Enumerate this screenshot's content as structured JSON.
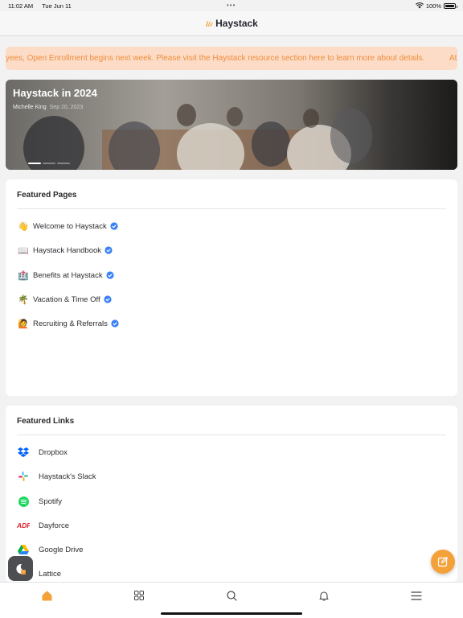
{
  "status_bar": {
    "time": "11:02 AM",
    "date": "Tue Jun 11",
    "battery": "100%",
    "dots": "•••"
  },
  "header": {
    "brand": "Haystack"
  },
  "announcement": {
    "text": "yees, Open Enrollment begins next week. Please visit the Haystack resource section here to learn more about details.",
    "text_continued": "At"
  },
  "hero": {
    "title": "Haystack in 2024",
    "author": "Michelle King",
    "date": "Sep 20, 2023"
  },
  "featured_pages": {
    "title": "Featured Pages",
    "items": [
      {
        "emoji": "👋",
        "label": "Welcome to Haystack"
      },
      {
        "emoji": "📖",
        "label": "Haystack Handbook"
      },
      {
        "emoji": "🏥",
        "label": "Benefits at Haystack"
      },
      {
        "emoji": "🌴",
        "label": "Vacation & Time Off"
      },
      {
        "emoji": "🙋",
        "label": "Recruiting & Referrals"
      }
    ]
  },
  "featured_links": {
    "title": "Featured Links",
    "items": [
      {
        "icon": "dropbox-icon",
        "label": "Dropbox"
      },
      {
        "icon": "slack-icon",
        "label": "Haystack's Slack"
      },
      {
        "icon": "spotify-icon",
        "label": "Spotify"
      },
      {
        "icon": "adp-icon",
        "label": "Dayforce"
      },
      {
        "icon": "google-drive-icon",
        "label": "Google Drive"
      },
      {
        "icon": "lattice-icon",
        "label": "Lattice"
      }
    ]
  },
  "colors": {
    "accent": "#f5a13a",
    "verified": "#3b82f6",
    "banner_bg": "#fcdcc6",
    "banner_text": "#ef8d3e"
  }
}
